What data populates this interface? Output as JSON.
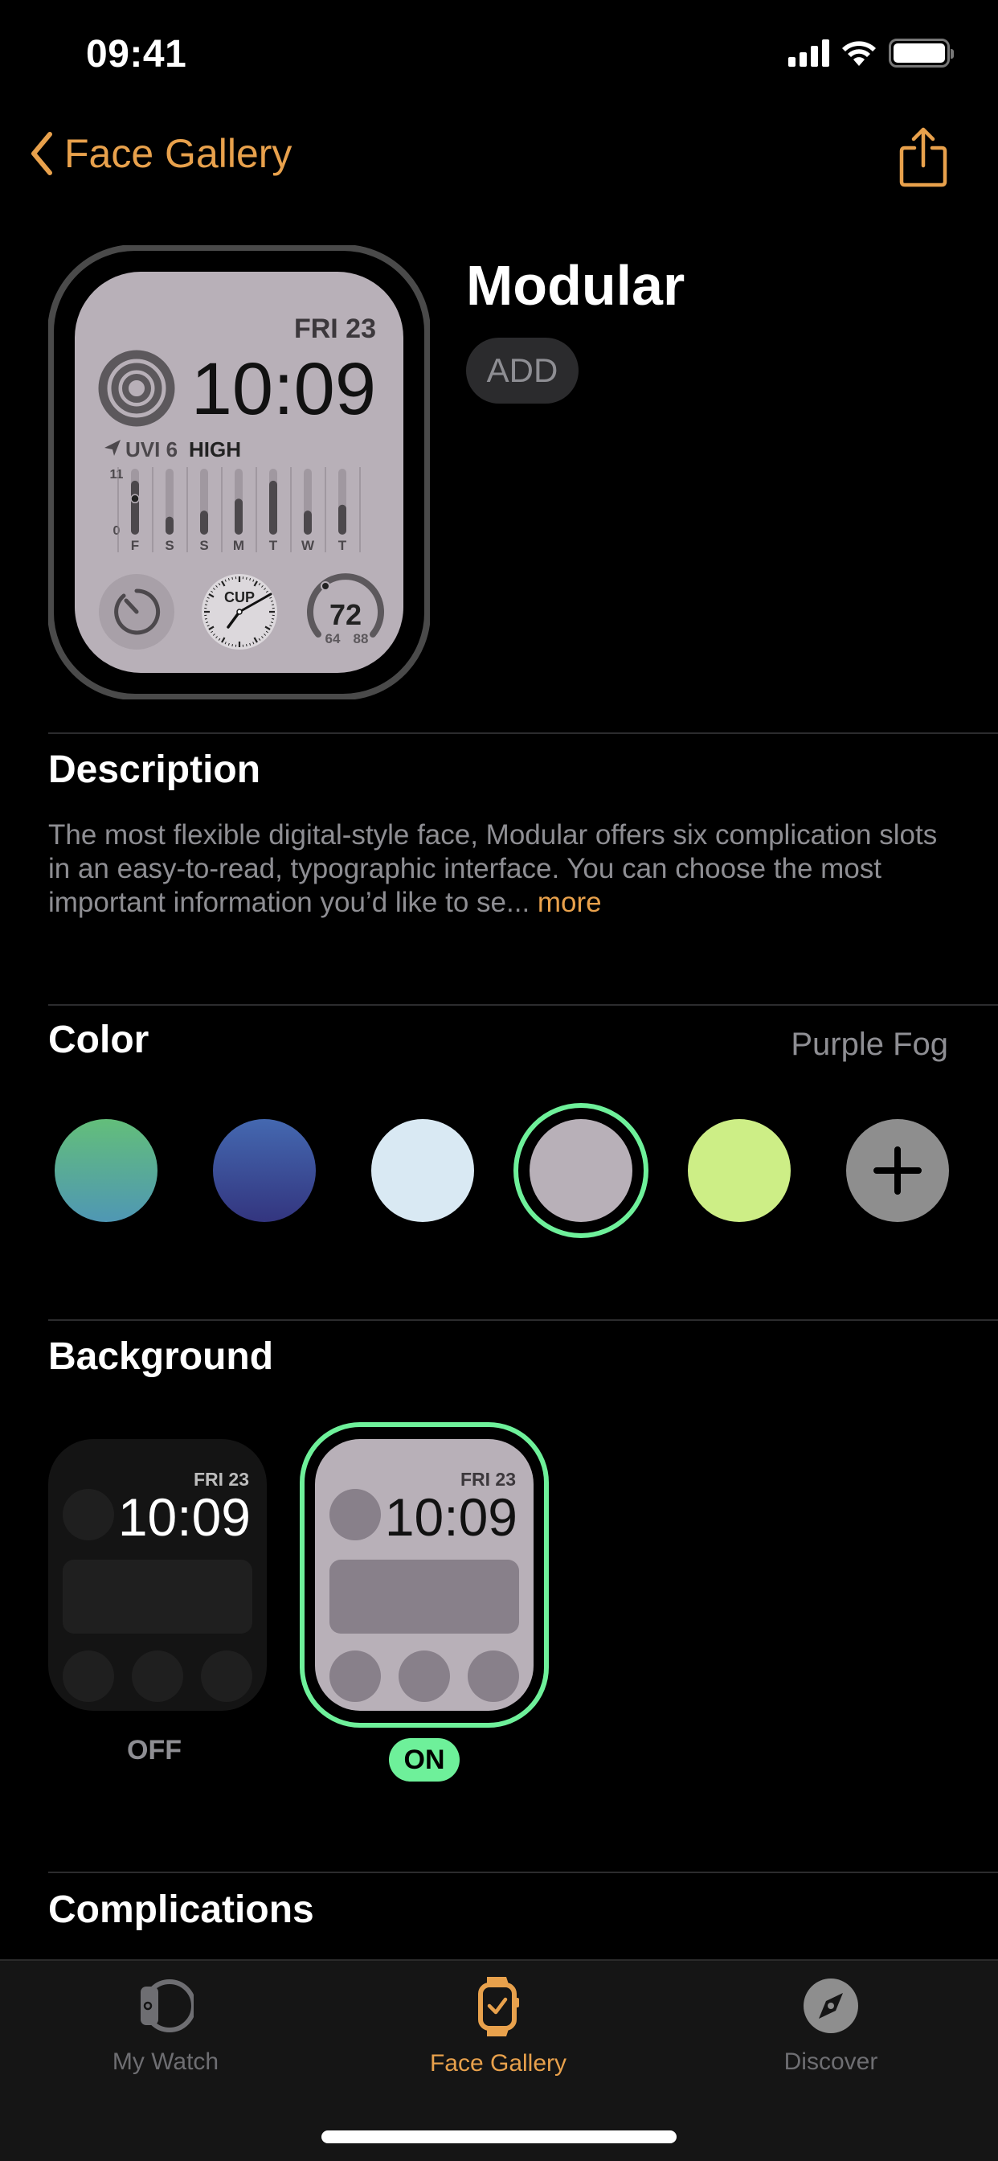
{
  "status_bar": {
    "time": "09:41"
  },
  "nav": {
    "back_label": "Face Gallery"
  },
  "face": {
    "title": "Modular",
    "add_label": "ADD",
    "preview": {
      "date": "FRI 23",
      "time": "10:09",
      "uv_label": "UVI 6",
      "uv_level": "HIGH",
      "uv_axis_max": "11",
      "uv_axis_min": "0",
      "uv_days": [
        "F",
        "S",
        "S",
        "M",
        "T",
        "W",
        "T"
      ],
      "uv_values": [
        9,
        3,
        4,
        6,
        9,
        4,
        5
      ],
      "uv_current": 6,
      "clock_label": "CUP",
      "temp": "72",
      "temp_low": "64",
      "temp_high": "88"
    }
  },
  "description": {
    "title": "Description",
    "text": "The most flexible digital-style face, Modular offers six complication slots in an easy-to-read, typographic interface. You can choose the most important information you’d like to se...",
    "more_label": "more"
  },
  "color": {
    "title": "Color",
    "selected_name": "Purple Fog",
    "swatches": [
      {
        "name": "green-teal",
        "top": "#63be7a",
        "bottom": "#4f97b4"
      },
      {
        "name": "blue",
        "top": "#4468b0",
        "bottom": "#33357f"
      },
      {
        "name": "light-blue",
        "top": "#d9e9f3",
        "bottom": "#d9e9f3"
      },
      {
        "name": "purple-fog",
        "top": "#b8b0b8",
        "bottom": "#b8b0b8",
        "selected": true
      },
      {
        "name": "lime",
        "top": "#cdee86",
        "bottom": "#cdee86"
      }
    ],
    "selection_color": "#6ef09a"
  },
  "background": {
    "title": "Background",
    "options": [
      {
        "label": "OFF",
        "date": "FRI 23",
        "time": "10:09"
      },
      {
        "label": "ON",
        "date": "FRI 23",
        "time": "10:09",
        "selected": true
      }
    ]
  },
  "complications": {
    "title": "Complications"
  },
  "tab_bar": {
    "tabs": [
      {
        "label": "My Watch",
        "icon": "watch-side-icon"
      },
      {
        "label": "Face Gallery",
        "icon": "watch-face-icon",
        "active": true
      },
      {
        "label": "Discover",
        "icon": "compass-icon"
      }
    ],
    "accent": "#e8a14c"
  }
}
